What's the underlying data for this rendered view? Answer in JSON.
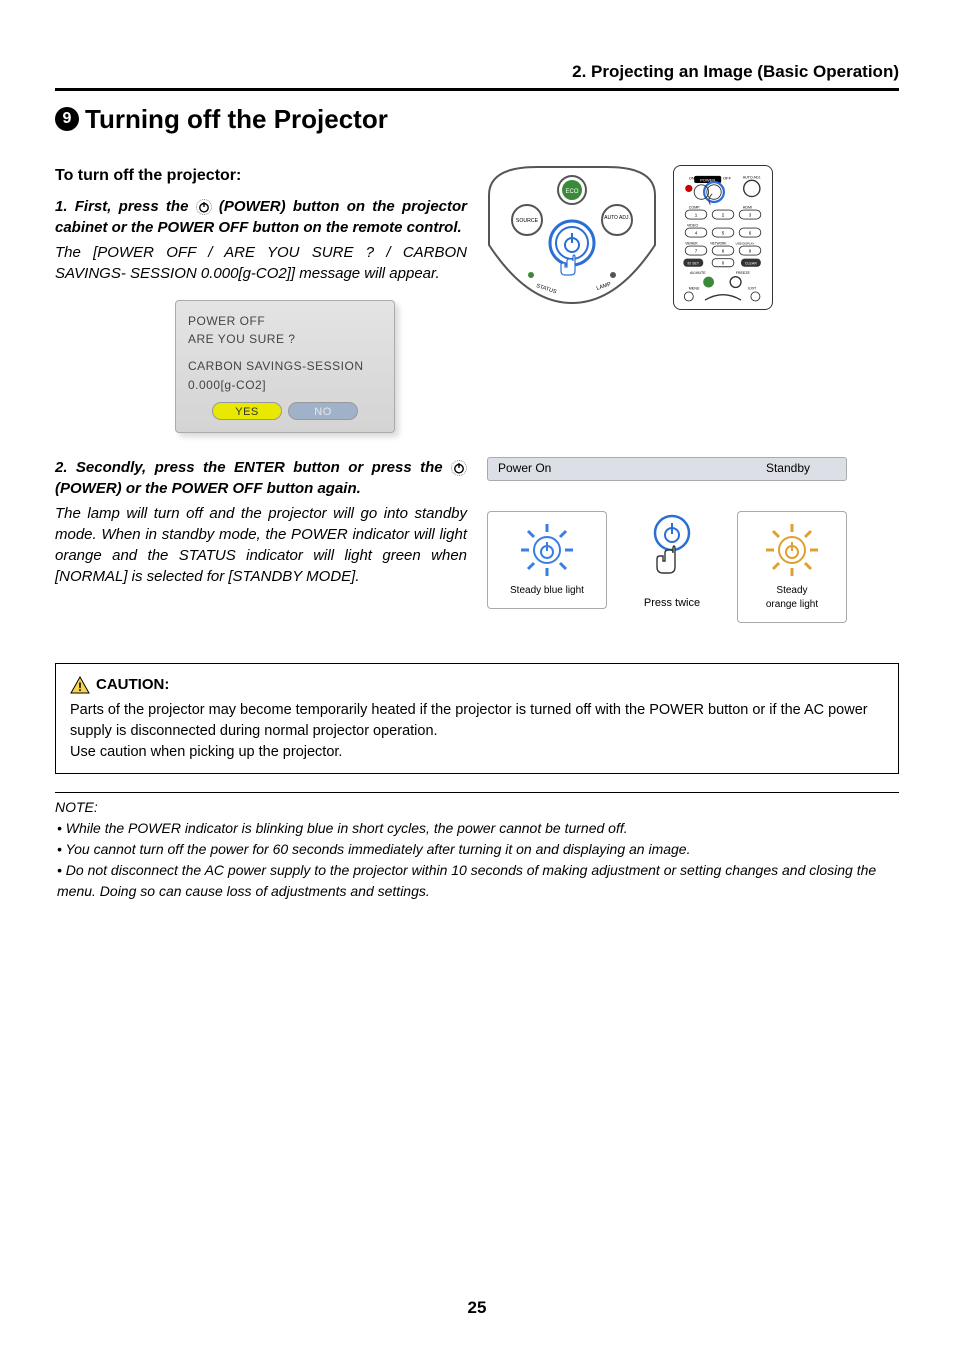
{
  "chapter": "2. Projecting an Image (Basic Operation)",
  "section_number": "9",
  "section_title": "Turning off the Projector",
  "subheading": "To turn off the projector:",
  "step1": {
    "text_pre": "1. First, press the ",
    "text_post": " (POWER) button on the projector cabinet or the POWER OFF button on the remote control.",
    "desc": "The [POWER OFF / ARE YOU SURE ? / CARBON SAVINGS- SESSION 0.000[g-CO2]] message will appear."
  },
  "osd": {
    "line1": "POWER OFF",
    "line2": "ARE YOU SURE ?",
    "line3": "CARBON SAVINGS-SESSION",
    "line4": "0.000[g-CO2]",
    "yes": "YES",
    "no": "NO"
  },
  "step2": {
    "text_pre": "2. Secondly, press the ENTER button or press the ",
    "text_post": " (POWER) or the POWER OFF button again.",
    "desc": "The lamp will turn off and the projector will go into standby mode. When in standby mode, the POWER indicator will light orange and the STATUS indicator will light green when [NORMAL] is selected for [STANDBY MODE]."
  },
  "panel_labels": {
    "eco": "ECO",
    "source": "SOURCE",
    "auto": "AUTO ADJ.",
    "status": "STATUS",
    "lamp": "LAMP"
  },
  "remote_labels": {
    "on": "ON",
    "power": "POWER",
    "off": "OFF",
    "autoadj": "AUTO ADJ.",
    "comp": "COMP.",
    "video": "VIDEO",
    "hdmi": "HDMI",
    "viewer": "VIEWER",
    "network": "NETWORK",
    "usb": "USB DISPLAY",
    "idset": "ID SET",
    "clear": "CLEAR",
    "avmute": "AV-MUTE",
    "freeze": "FREEZE",
    "menu": "MENU",
    "exit": "EXIT",
    "n1": "1",
    "n2": "2",
    "n3": "3",
    "n4": "4",
    "n5": "5",
    "n6": "6",
    "n7": "7",
    "n8": "8",
    "n9": "9",
    "n0": "0"
  },
  "led": {
    "header_left": "Power On",
    "header_right": "Standby",
    "box1": "Steady blue light",
    "press": "Press twice",
    "box2a": "Steady",
    "box2b": "orange light"
  },
  "caution": {
    "title": "CAUTION:",
    "body1": "Parts of the projector may become temporarily heated if the projector is turned off with the POWER button or if the AC power supply is disconnected during normal projector operation.",
    "body2": "Use caution when picking up the projector."
  },
  "note": {
    "title": "NOTE:",
    "b1": "While the POWER indicator is blinking blue in short cycles, the power cannot be turned off.",
    "b2": "You cannot turn off the power for 60 seconds immediately after turning it on and displaying an image.",
    "b3": "Do not disconnect the AC power supply to the projector within 10 seconds of making adjustment or setting changes and closing the menu. Doing so can cause loss of adjustments and settings."
  },
  "page_number": "25"
}
